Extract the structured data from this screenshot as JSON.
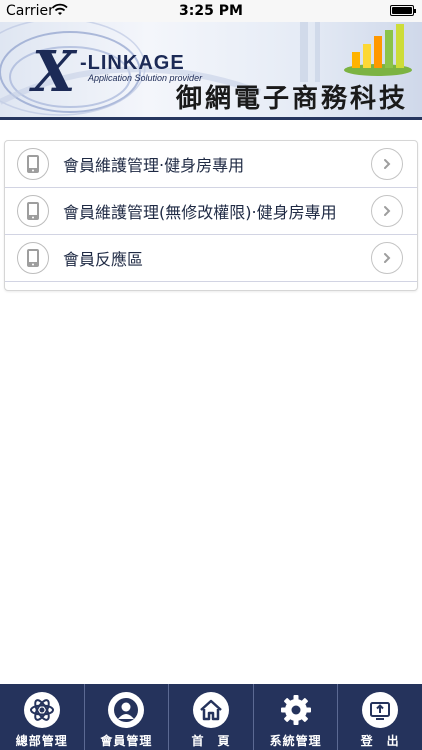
{
  "status_bar": {
    "carrier": "Carrier",
    "time": "3:25 PM"
  },
  "banner": {
    "logo_x": "X",
    "logo_brand": "-LINKAGE",
    "tagline": "Application Solution provider",
    "company_name": "御網電子商務科技"
  },
  "menu": {
    "items": [
      {
        "label": "會員維護管理‧健身房專用",
        "icon": "phone-icon"
      },
      {
        "label": "會員維護管理(無修改權限)‧健身房專用",
        "icon": "phone-icon"
      },
      {
        "label": "會員反應區",
        "icon": "phone-icon"
      }
    ]
  },
  "tabbar": {
    "items": [
      {
        "label": "總部管理",
        "icon": "atom-icon"
      },
      {
        "label": "會員管理",
        "icon": "user-icon"
      },
      {
        "label": "首　頁",
        "icon": "home-icon"
      },
      {
        "label": "系統管理",
        "icon": "gear-icon"
      },
      {
        "label": "登　出",
        "icon": "logout-icon"
      }
    ]
  },
  "colors": {
    "tabbar_bg": "#25335c",
    "banner_accent": "#1c2a56",
    "list_text": "#1f2a44"
  }
}
